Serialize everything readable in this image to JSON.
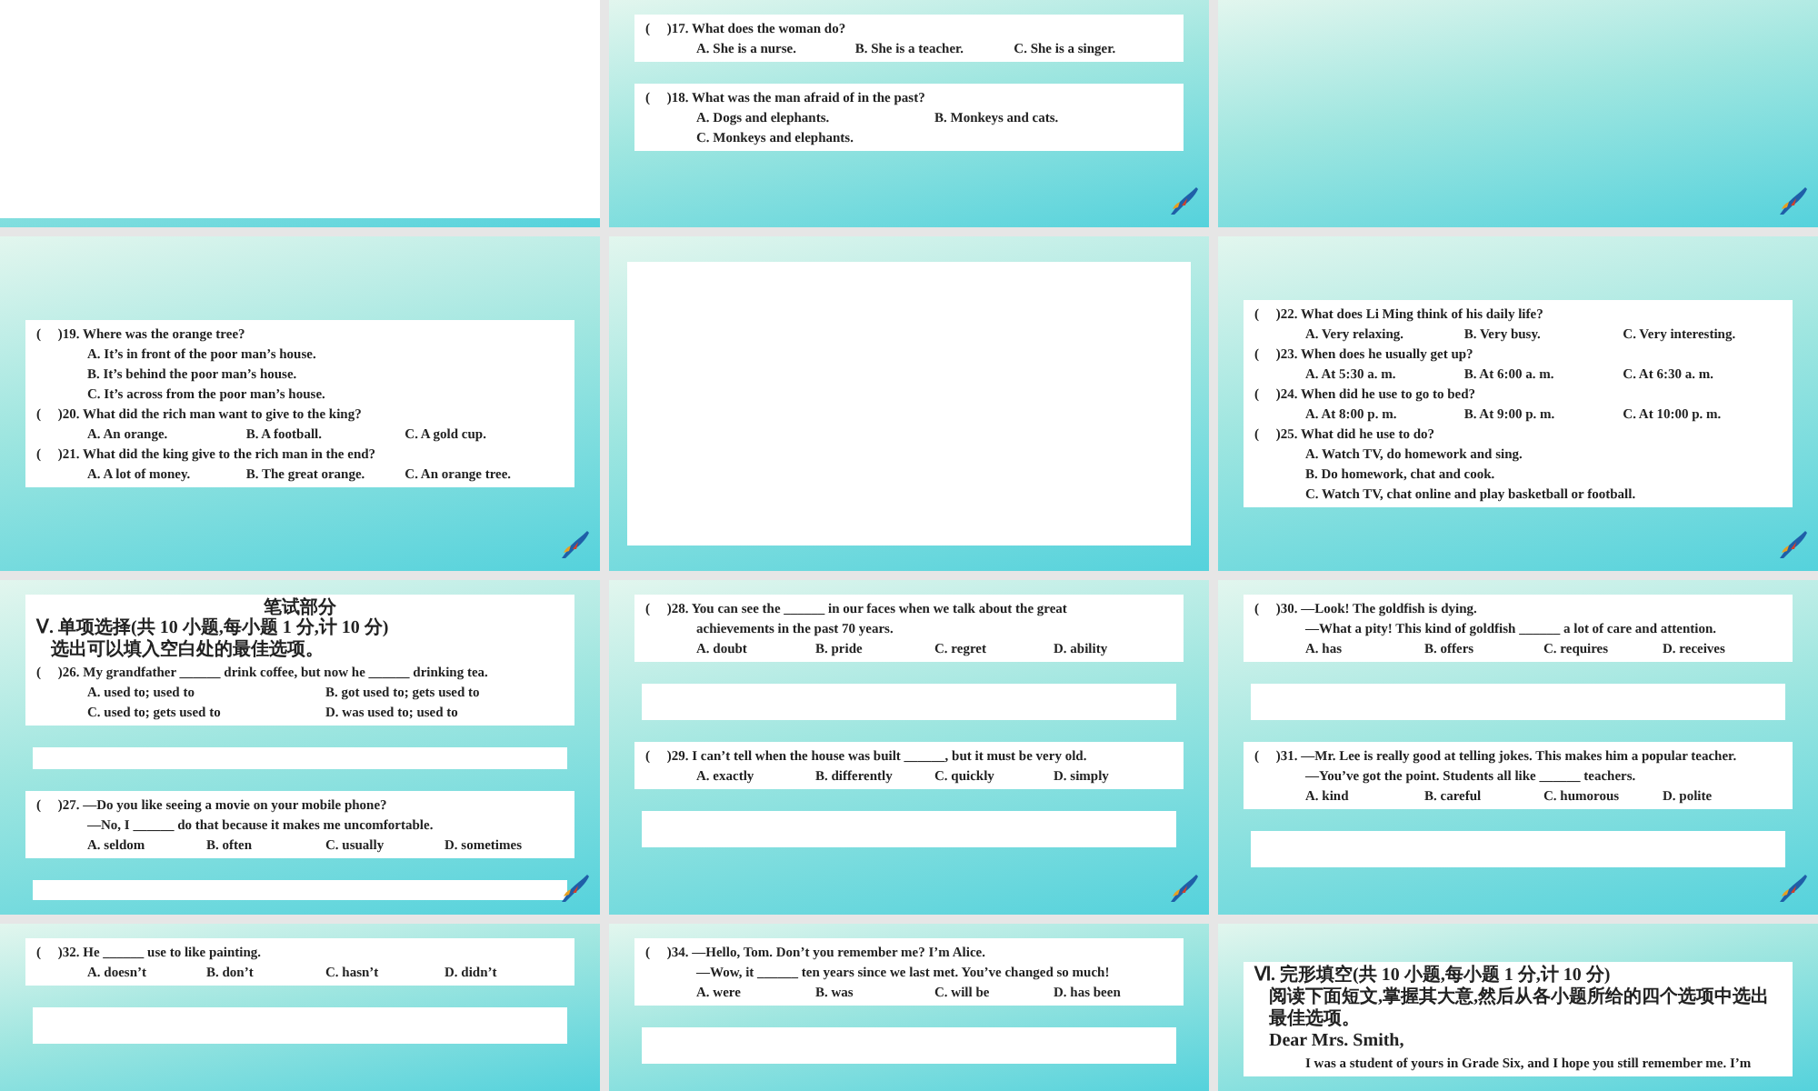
{
  "slides": [
    {
      "parrot": false,
      "panels": [
        {
          "kind": "sheet"
        }
      ]
    },
    {
      "parrot": true,
      "panels": [
        {
          "kind": "text",
          "lines": [
            {
              "kind": "question",
              "text": "(     )17. What does the woman do?"
            },
            {
              "kind": "options",
              "items": [
                "A. She is a nurse.",
                "B. She is a teacher.",
                "C. She is a singer."
              ]
            }
          ]
        },
        {
          "kind": "text",
          "lines": [
            {
              "kind": "question",
              "text": "(     )18. What was the man afraid of in the past?"
            },
            {
              "kind": "options",
              "items": [
                "A. Dogs and elephants.",
                "B. Monkeys and cats."
              ]
            },
            {
              "kind": "options",
              "items": [
                "C. Monkeys and elephants."
              ]
            }
          ]
        }
      ]
    },
    {
      "parrot": true
    },
    {
      "parrot": true,
      "panels": [
        {
          "kind": "text",
          "lines": [
            {
              "kind": "question",
              "text": "(     )19. Where was the orange tree?"
            },
            {
              "kind": "continued",
              "text": "A. It’s in front of the poor man’s house."
            },
            {
              "kind": "continued",
              "text": "B. It’s behind the poor man’s house."
            },
            {
              "kind": "continued",
              "text": "C. It’s across from the poor man’s house."
            },
            {
              "kind": "question",
              "text": "(     )20. What did the rich man want to give to the king?"
            },
            {
              "kind": "options",
              "items": [
                "A. An orange.",
                "B. A football.",
                "C. A gold cup."
              ]
            },
            {
              "kind": "question",
              "text": "(     )21. What did the king give to the rich man in the end?"
            },
            {
              "kind": "options",
              "items": [
                "A. A lot of money.",
                "B. The great orange.",
                "C. An orange tree."
              ]
            }
          ]
        }
      ]
    },
    {
      "parrot": false,
      "panels": [
        {
          "kind": "sheet"
        }
      ]
    },
    {
      "parrot": true,
      "panels": [
        {
          "kind": "text",
          "lines": [
            {
              "kind": "question",
              "text": "(     )22. What does Li Ming think of his daily life?"
            },
            {
              "kind": "options",
              "items": [
                "A. Very relaxing.",
                "B. Very busy.",
                "C. Very interesting."
              ]
            },
            {
              "kind": "question",
              "text": "(     )23. When does he usually get up?"
            },
            {
              "kind": "options",
              "items": [
                "A. At 5:30 a. m.",
                "B. At 6:00 a. m.",
                "C. At 6:30 a. m."
              ]
            },
            {
              "kind": "question",
              "text": "(     )24. When did he use to go to bed?"
            },
            {
              "kind": "options",
              "items": [
                "A. At 8:00 p. m.",
                "B. At 9:00 p. m.",
                "C. At 10:00 p. m."
              ]
            },
            {
              "kind": "question",
              "text": "(     )25. What did he use to do?"
            },
            {
              "kind": "continued",
              "text": "A. Watch TV, do homework and sing."
            },
            {
              "kind": "continued",
              "text": "B. Do homework, chat and cook."
            },
            {
              "kind": "continued",
              "text": "C. Watch TV, chat online and play basketball or football."
            }
          ]
        }
      ]
    },
    {
      "parrot": true,
      "panels": [
        {
          "kind": "text",
          "lines": [
            {
              "kind": "heading",
              "text": "笔试部分"
            },
            {
              "kind": "section",
              "text": "Ⅴ. 单项选择(共 10 小题,每小题 1 分,计 10 分)"
            },
            {
              "kind": "note",
              "text": "选出可以填入空白处的最佳选项。"
            },
            {
              "kind": "question",
              "text": "(     )26. My grandfather ______ drink coffee, but now he ______ drinking tea."
            },
            {
              "kind": "options",
              "items": [
                "A. used to; used to",
                "B. got used to; gets used to"
              ]
            },
            {
              "kind": "options",
              "items": [
                "C. used to; gets used to",
                "D. was used to; used to"
              ]
            }
          ]
        },
        {
          "kind": "blank"
        },
        {
          "kind": "text",
          "lines": [
            {
              "kind": "question",
              "text": "(     )27. —Do you like seeing a movie on your mobile phone?"
            },
            {
              "kind": "continued",
              "text": "—No, I ______ do that because it makes me uncomfortable."
            },
            {
              "kind": "options",
              "items": [
                "A. seldom",
                "B. often",
                "C. usually",
                "D. sometimes"
              ]
            }
          ]
        },
        {
          "kind": "blank"
        }
      ]
    },
    {
      "parrot": true,
      "panels": [
        {
          "kind": "text",
          "lines": [
            {
              "kind": "question",
              "text": "(     )28. You can see the ______ in our faces when we talk about the great"
            },
            {
              "kind": "continued",
              "text": "achievements in the past 70 years."
            },
            {
              "kind": "options",
              "items": [
                "A. doubt",
                "B. pride",
                "C. regret",
                "D. ability"
              ]
            }
          ]
        },
        {
          "kind": "blank"
        },
        {
          "kind": "text",
          "lines": [
            {
              "kind": "question",
              "text": "(     )29. I can’t tell when the house was built ______, but it must be very old."
            },
            {
              "kind": "options",
              "items": [
                "A. exactly",
                "B. differently",
                "C. quickly",
                "D. simply"
              ]
            }
          ]
        },
        {
          "kind": "blank"
        }
      ]
    },
    {
      "parrot": true,
      "panels": [
        {
          "kind": "text",
          "lines": [
            {
              "kind": "question",
              "text": "(     )30. —Look! The goldfish is dying."
            },
            {
              "kind": "continued",
              "text": "—What a pity! This kind of goldfish ______ a lot of care and attention."
            },
            {
              "kind": "options",
              "items": [
                "A. has",
                "B. offers",
                "C. requires",
                "D. receives"
              ]
            }
          ]
        },
        {
          "kind": "blank"
        },
        {
          "kind": "text",
          "lines": [
            {
              "kind": "question",
              "text": "(     )31. —Mr. Lee is really good at telling jokes. This makes him a popular teacher."
            },
            {
              "kind": "continued",
              "text": "—You’ve got the point. Students all like ______ teachers."
            },
            {
              "kind": "options",
              "items": [
                "A. kind",
                "B. careful",
                "C. humorous",
                "D. polite"
              ]
            }
          ]
        },
        {
          "kind": "blank"
        }
      ]
    },
    {
      "parrot": false,
      "panels": [
        {
          "kind": "text",
          "lines": [
            {
              "kind": "question",
              "text": "(     )32. He ______ use to like painting."
            },
            {
              "kind": "options",
              "items": [
                "A. doesn’t",
                "B. don’t",
                "C. hasn’t",
                "D. didn’t"
              ]
            }
          ]
        },
        {
          "kind": "blank"
        }
      ]
    },
    {
      "parrot": false,
      "panels": [
        {
          "kind": "text",
          "lines": [
            {
              "kind": "question",
              "text": "(     )34. —Hello, Tom. Don’t you remember me? I’m Alice."
            },
            {
              "kind": "continued",
              "text": "—Wow, it ______ ten years since we last met. You’ve changed so much!"
            },
            {
              "kind": "options",
              "items": [
                "A. were",
                "B. was",
                "C. will be",
                "D. has been"
              ]
            }
          ]
        },
        {
          "kind": "blank"
        }
      ]
    },
    {
      "parrot": false,
      "panels": [
        {
          "kind": "text",
          "lines": [
            {
              "kind": "section",
              "text": "Ⅵ. 完形填空(共 10 小题,每小题 1 分,计 10 分)"
            },
            {
              "kind": "note",
              "text": "阅读下面短文,掌握其大意,然后从各小题所给的四个选项中选出最佳选项。"
            },
            {
              "kind": "note",
              "text": "Dear Mrs. Smith,"
            },
            {
              "kind": "continued",
              "text": "I was a student of yours in Grade Six, and I hope you still remember me. I’m"
            }
          ]
        }
      ]
    }
  ]
}
